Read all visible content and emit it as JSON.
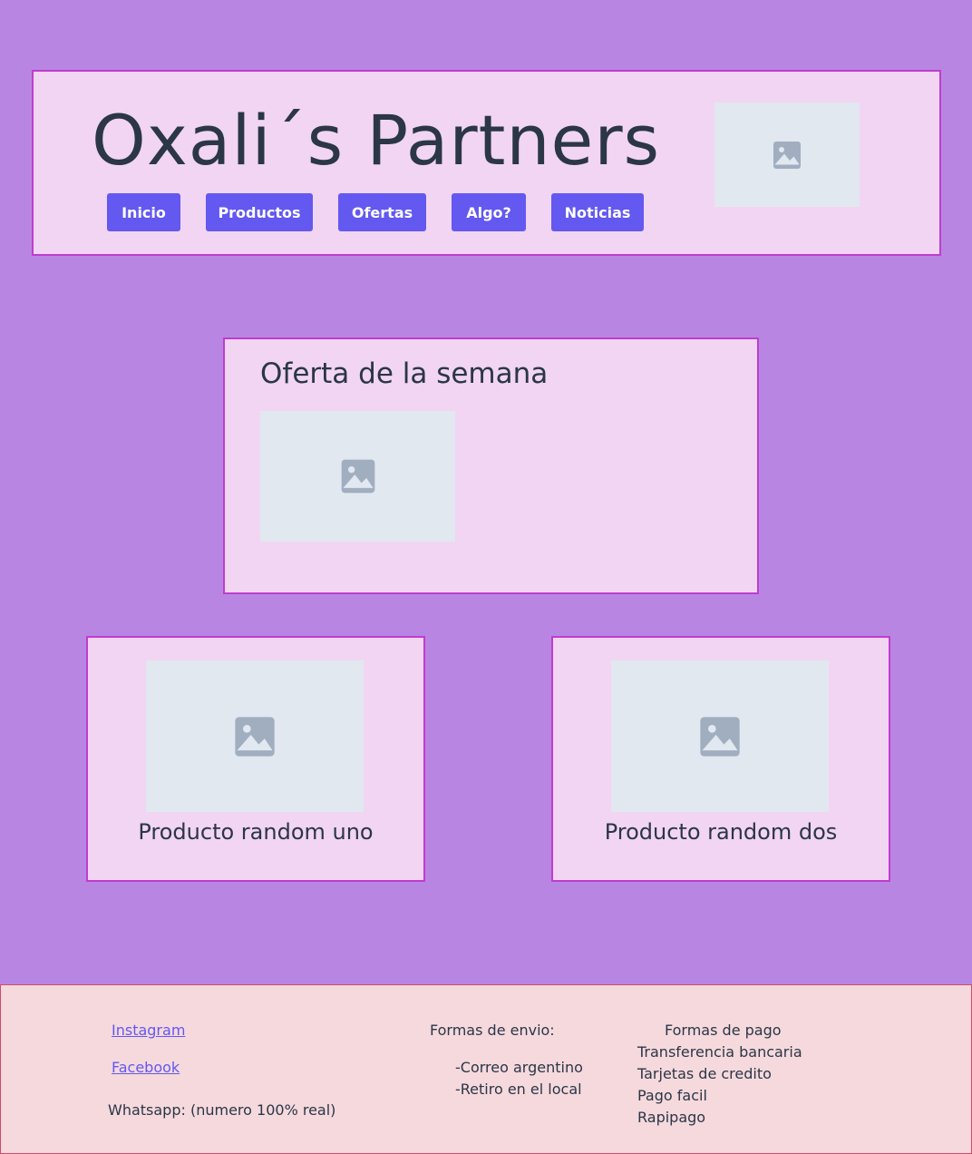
{
  "header": {
    "title": "Oxali´s Partners",
    "nav": [
      {
        "label": "Inicio"
      },
      {
        "label": "Productos"
      },
      {
        "label": "Ofertas"
      },
      {
        "label": "Algo?"
      },
      {
        "label": "Noticias"
      }
    ],
    "logo_icon": "image-placeholder-icon"
  },
  "offer": {
    "title": "Oferta de la semana",
    "image_icon": "image-placeholder-icon"
  },
  "products": [
    {
      "name": "Producto random uno",
      "image_icon": "image-placeholder-icon"
    },
    {
      "name": "Producto random dos",
      "image_icon": "image-placeholder-icon"
    }
  ],
  "footer": {
    "social": {
      "instagram": "Instagram",
      "facebook": "Facebook",
      "whatsapp": "Whatsapp: (numero 100% real)"
    },
    "shipping": {
      "title": "Formas de envio:",
      "items": [
        "-Correo argentino",
        "-Retiro en el local"
      ]
    },
    "payment": {
      "title": "Formas de pago",
      "items": [
        "Transferencia bancaria",
        "Tarjetas de credito",
        "Pago facil",
        "Rapipago"
      ]
    }
  },
  "colors": {
    "page_background": "#b886e2",
    "panel_background": "#f1d5f3",
    "panel_border": "#c03ccf",
    "button": "#6358f0",
    "footer_background": "#f5d9dd",
    "placeholder": "#e2e8f0",
    "placeholder_icon": "#a0aec0"
  }
}
